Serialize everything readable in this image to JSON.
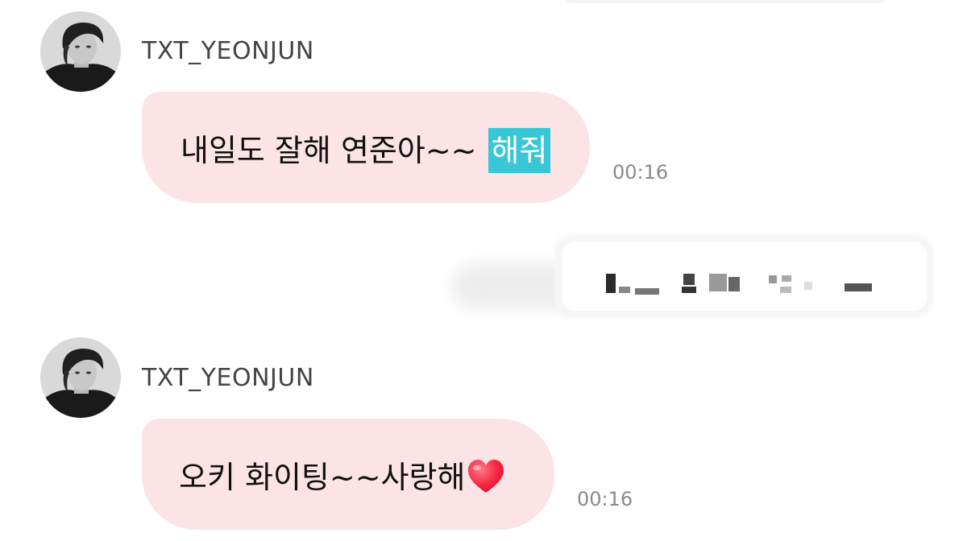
{
  "messages": [
    {
      "sender": "TXT_YEONJUN",
      "text": "내일도 잘해 연준아~~",
      "highlight": "해줘",
      "time": "00:16"
    },
    {
      "sender": "TXT_YEONJUN",
      "text": "오키 화이팅~~사랑해",
      "emoji": "heart-emoji",
      "time": "00:16"
    }
  ],
  "colors": {
    "bubble": "#fbe3e6",
    "highlight": "#38c7d6",
    "timestamp": "#8a8a8a",
    "heart": "#ff3b55"
  }
}
